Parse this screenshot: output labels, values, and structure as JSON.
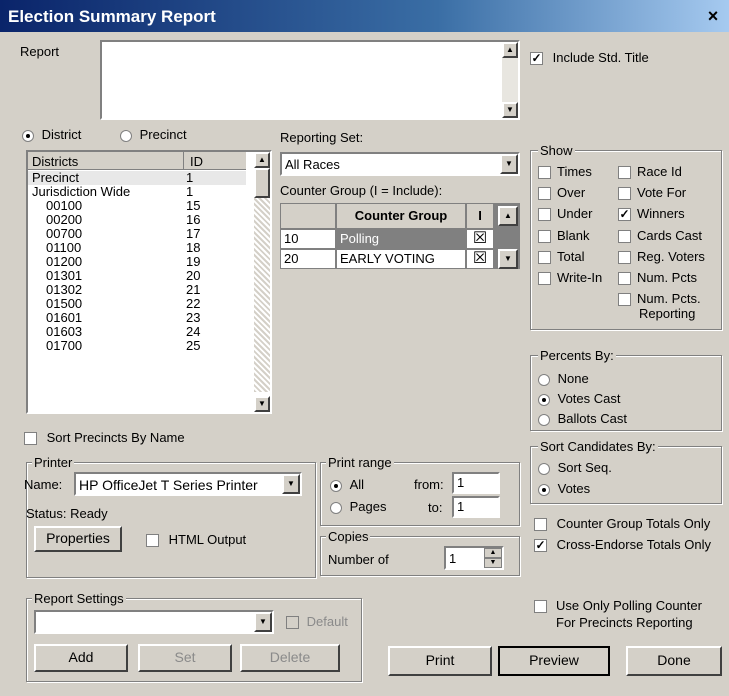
{
  "window": {
    "title": "Election Summary Report",
    "close": "×"
  },
  "report": {
    "label": "Report",
    "value": "",
    "include_std_title": "Include Std. Title",
    "include_std_title_checked": true
  },
  "scope": {
    "district": "District",
    "precinct": "Precinct",
    "selected": "District"
  },
  "districts": {
    "headers": [
      "Districts",
      "ID"
    ],
    "rows": [
      [
        "Precinct",
        "1"
      ],
      [
        "Jurisdiction Wide",
        "1"
      ],
      [
        "00100",
        "15"
      ],
      [
        "00200",
        "16"
      ],
      [
        "00700",
        "17"
      ],
      [
        "01100",
        "18"
      ],
      [
        "01200",
        "19"
      ],
      [
        "01301",
        "20"
      ],
      [
        "01302",
        "21"
      ],
      [
        "01500",
        "22"
      ],
      [
        "01601",
        "23"
      ],
      [
        "01603",
        "24"
      ],
      [
        "01700",
        "25"
      ]
    ]
  },
  "reporting_set": {
    "label": "Reporting Set:",
    "value": "All Races"
  },
  "counter_group": {
    "label": "Counter Group (I = Include):",
    "headers": [
      "Counter Group",
      "I"
    ],
    "rows": [
      {
        "id": "10",
        "name": "Polling",
        "include": "☒"
      },
      {
        "id": "20",
        "name": "EARLY VOTING",
        "include": "☒"
      }
    ]
  },
  "show": {
    "title": "Show",
    "items": [
      {
        "label": "Times",
        "checked": false
      },
      {
        "label": "Race Id",
        "checked": false
      },
      {
        "label": "Over",
        "checked": false
      },
      {
        "label": "Vote For",
        "checked": false
      },
      {
        "label": "Under",
        "checked": false
      },
      {
        "label": "Winners",
        "checked": true
      },
      {
        "label": "Blank",
        "checked": false
      },
      {
        "label": "Cards Cast",
        "checked": false
      },
      {
        "label": "Total",
        "checked": false
      },
      {
        "label": "Reg. Voters",
        "checked": false
      },
      {
        "label": "Write-In",
        "checked": false
      },
      {
        "label": "Num. Pcts",
        "checked": false
      },
      {
        "label": "Num. Pcts.",
        "label2": "Reporting",
        "checked": false
      }
    ]
  },
  "percents_by": {
    "title": "Percents By:",
    "options": [
      "None",
      "Votes Cast",
      "Ballots Cast"
    ],
    "selected": "Votes Cast"
  },
  "sort_candidates": {
    "title": "Sort Candidates By:",
    "options": [
      "Sort Seq.",
      "Votes"
    ],
    "selected": "Votes"
  },
  "totals": {
    "counter_group_totals": "Counter Group Totals Only",
    "cross_endorse_totals": "Cross-Endorse Totals Only",
    "cross_endorse_checked": true,
    "use_only_polling": "Use Only Polling Counter",
    "use_only_polling2": "For Precincts Reporting"
  },
  "sort_precincts": "Sort Precincts By Name",
  "printer": {
    "title": "Printer",
    "name_label": "Name:",
    "name_value": "HP OfficeJet T Series Printer",
    "status": "Status: Ready",
    "properties": "Properties",
    "html_output": "HTML Output"
  },
  "print_range": {
    "title": "Print range",
    "all": "All",
    "pages": "Pages",
    "from_label": "from:",
    "to_label": "to:",
    "from": "1",
    "to": "1"
  },
  "copies": {
    "title": "Copies",
    "label": "Number of",
    "value": "1"
  },
  "report_settings": {
    "title": "Report Settings",
    "value": "",
    "default": "Default",
    "add": "Add",
    "set": "Set",
    "delete": "Delete"
  },
  "actions": {
    "print": "Print",
    "preview": "Preview",
    "done": "Done"
  }
}
